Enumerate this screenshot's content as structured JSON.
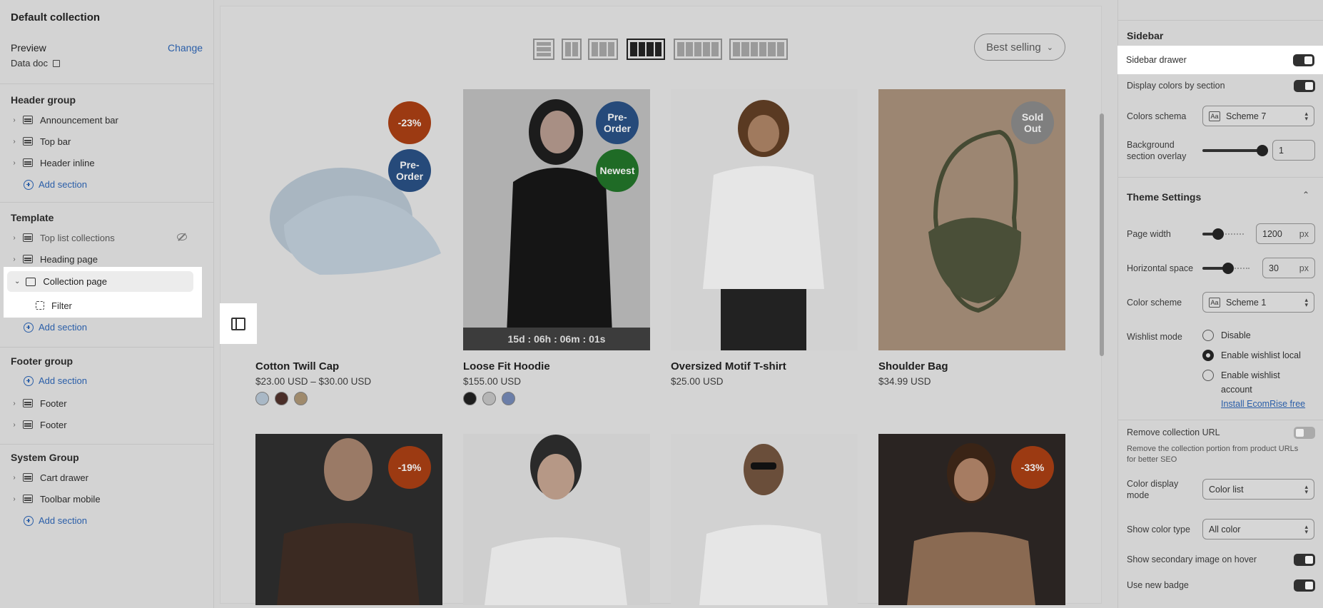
{
  "left": {
    "title": "Default collection",
    "preview_label": "Preview",
    "change_label": "Change",
    "preview_value": "Data doc",
    "header_group": {
      "title": "Header group",
      "items": [
        "Announcement bar",
        "Top bar",
        "Header inline"
      ],
      "add_label": "Add section"
    },
    "template": {
      "title": "Template",
      "items": [
        "Top list collections",
        "Heading page",
        "Collection page"
      ],
      "child": "Filter",
      "add_label": "Add section"
    },
    "footer_group": {
      "title": "Footer group",
      "add_label": "Add section",
      "items": [
        "Footer",
        "Footer"
      ]
    },
    "system_group": {
      "title": "System Group",
      "items": [
        "Cart drawer",
        "Toolbar mobile"
      ],
      "add_label": "Add section"
    }
  },
  "center": {
    "sort_label": "Best selling",
    "products": [
      {
        "name": "Cotton Twill Cap",
        "price": "$23.00 USD – $30.00 USD",
        "badges": [
          "-23%",
          "Pre-\nOrder"
        ],
        "swatches": [
          "#a9b8c6",
          "#4a2e28",
          "#9f8a6c"
        ]
      },
      {
        "name": "Loose Fit Hoodie",
        "price": "$155.00 USD",
        "badges": [
          "Pre-\nOrder",
          "Newest"
        ],
        "countdown": "15d : 06h : 06m : 01s",
        "swatches": [
          "#1e1e1e",
          "#b5b5b5",
          "#6b7ea8"
        ]
      },
      {
        "name": "Oversized Motif T-shirt",
        "price": "$25.00 USD",
        "badges": [],
        "swatches": []
      },
      {
        "name": "Shoulder Bag",
        "price": "$34.99 USD",
        "badges": [
          "Sold\nOut"
        ],
        "swatches": []
      }
    ],
    "row2_badges": [
      "-19%",
      "",
      "",
      "-33%"
    ]
  },
  "right": {
    "sidebar_title": "Sidebar",
    "sidebar_drawer": "Sidebar drawer",
    "display_colors": "Display colors by section",
    "colors_schema_label": "Colors schema",
    "colors_schema_value": "Scheme 7",
    "bg_overlay_label": "Background section overlay",
    "bg_overlay_value": "1",
    "theme_settings": "Theme Settings",
    "page_width_label": "Page width",
    "page_width_value": "1200",
    "page_width_unit": "px",
    "hspace_label": "Horizontal space",
    "hspace_value": "30",
    "hspace_unit": "px",
    "color_scheme_label": "Color scheme",
    "color_scheme_value": "Scheme 1",
    "wishlist_label": "Wishlist mode",
    "wishlist_options": [
      "Disable",
      "Enable wishlist local",
      "Enable wishlist account"
    ],
    "install_link": "Install EcomRise free",
    "remove_url_label": "Remove collection URL",
    "remove_url_desc": "Remove the collection portion from product URLs for better SEO",
    "color_display_label": "Color display mode",
    "color_display_value": "Color list",
    "show_color_type_label": "Show color type",
    "show_color_type_value": "All color",
    "secondary_image_label": "Show secondary image on hover",
    "new_badge_label": "Use new badge"
  }
}
